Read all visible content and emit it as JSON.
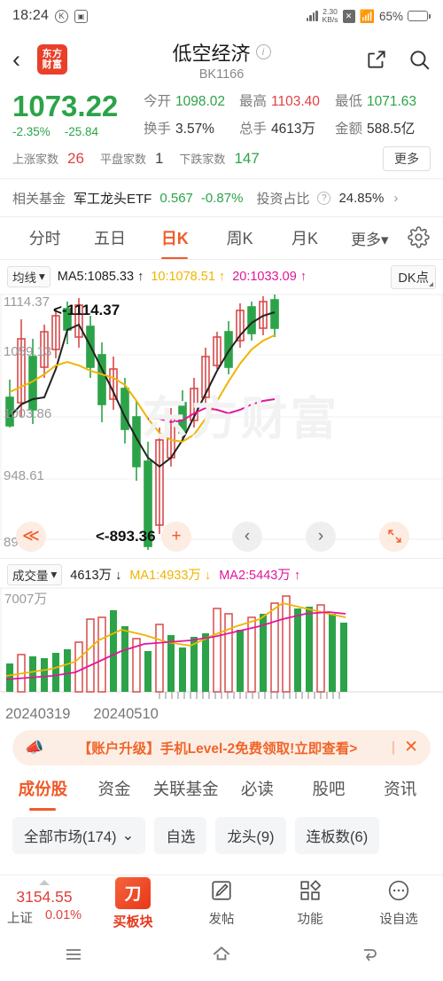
{
  "status_bar": {
    "time": "18:24",
    "icons": [
      "circle-k-icon",
      "screenshot-icon",
      "vibrate-icon",
      "sim-x-icon",
      "wifi-icon"
    ],
    "net_speed_value": "2.30",
    "net_speed_unit": "KB/s",
    "battery": "65%"
  },
  "header": {
    "back_icon": "chevron-left-icon",
    "logo_line1": "东方",
    "logo_line2": "财富",
    "title": "低空经济",
    "info_icon": "info-icon",
    "code": "BK1166",
    "share_icon": "share-icon",
    "search_icon": "search-icon"
  },
  "quote": {
    "price": "1073.22",
    "change_pct": "-2.35%",
    "change_val": "-25.84",
    "open_label": "今开",
    "open_value": "1098.02",
    "high_label": "最高",
    "high_value": "1103.40",
    "low_label": "最低",
    "low_value": "1071.63",
    "turnover_label": "换手",
    "turnover_value": "3.57%",
    "volume_label": "总手",
    "volume_value": "4613万",
    "amount_label": "金额",
    "amount_value": "588.5亿",
    "up_label": "上涨家数",
    "up_value": "26",
    "flat_label": "平盘家数",
    "flat_value": "1",
    "down_label": "下跌家数",
    "down_value": "147",
    "more_button": "更多",
    "color_up": "#e04040",
    "color_down": "#2ca349"
  },
  "fund_row": {
    "label": "相关基金",
    "name": "军工龙头ETF",
    "price": "0.567",
    "change_pct": "-0.87%",
    "ratio_label": "投资占比",
    "help_icon": "question-icon",
    "ratio_value": "24.85%",
    "arrow": "›"
  },
  "chart_tabs": {
    "items": [
      {
        "label": "分时",
        "active": false
      },
      {
        "label": "五日",
        "active": false
      },
      {
        "label": "日K",
        "active": true
      },
      {
        "label": "周K",
        "active": false
      },
      {
        "label": "月K",
        "active": false
      },
      {
        "label": "更多▾",
        "active": false
      }
    ],
    "settings_icon": "gear-icon"
  },
  "ma_bar": {
    "selector": "均线",
    "selector_caret": "▾",
    "ma5": "MA5:1085.33 ↑",
    "ma10": "10:1078.51 ↑",
    "ma20": "20:1033.09 ↑",
    "dk_button": "DK点"
  },
  "chart_data": {
    "type": "line",
    "title": "低空经济 日K",
    "y_axis_labels": [
      "1114.37",
      "1059.13",
      "1003.86",
      "948.61",
      "893.36"
    ],
    "ylim": [
      893.36,
      1114.37
    ],
    "annotation_high": "<-1114.37",
    "annotation_low": "<-893.36",
    "watermark": "东方财富",
    "series": [
      {
        "name": "MA5",
        "color": "#222222",
        "values": [
          1025,
          1018,
          1012,
          1015,
          1030,
          1050,
          1068,
          1072,
          1060,
          1040,
          1018,
          995,
          975,
          958,
          948,
          945,
          952,
          968,
          990,
          1012,
          1035,
          1052,
          1066,
          1076,
          1082,
          1085
        ]
      },
      {
        "name": "MA10",
        "color": "#f0b400",
        "values": [
          1042,
          1045,
          1046,
          1047,
          1046,
          1044,
          1040,
          1035,
          1028,
          1018,
          1006,
          995,
          985,
          978,
          974,
          972,
          975,
          982,
          995,
          1010,
          1026,
          1042,
          1056,
          1066,
          1074,
          1078
        ]
      },
      {
        "name": "MA20",
        "color": "#e0179c",
        "values": [
          null,
          null,
          null,
          null,
          null,
          null,
          null,
          null,
          null,
          null,
          null,
          null,
          1000,
          998,
          997,
          999,
          1003,
          1008,
          1010,
          1012,
          1016,
          1021,
          1025,
          1029,
          1031,
          1033
        ]
      }
    ],
    "candles_note": "K-line candles: green = down, hollow red = up",
    "volume": {
      "header_selector": "成交量",
      "header_caret": "▾",
      "current": "4613万 ↓",
      "ma1": "MA1:4933万 ↓",
      "ma2": "MA2:5443万 ↑",
      "max_label": "7007万",
      "ymax": 7007
    },
    "x_axis_labels": [
      "20240319",
      "20240510"
    ]
  },
  "chart_controls": {
    "zoom_out_icon": "double-chevron-left-icon",
    "zoom_in_icon": "plus-icon",
    "prev_icon": "chevron-left-icon",
    "next_icon": "chevron-right-icon",
    "fullscreen_icon": "expand-icon"
  },
  "banner": {
    "megaphone_icon": "megaphone-icon",
    "text": "【账户升级】手机Level-2免费领取!立即查看>",
    "separator": "|",
    "close_icon": "✕"
  },
  "bottom_tabs": {
    "items": [
      {
        "label": "成份股",
        "active": true
      },
      {
        "label": "资金",
        "active": false
      },
      {
        "label": "关联基金",
        "active": false
      },
      {
        "label": "必读",
        "active": false
      },
      {
        "label": "股吧",
        "active": false
      },
      {
        "label": "资讯",
        "active": false
      }
    ]
  },
  "filter_chips": [
    {
      "label": "全部市场(174)",
      "caret": "⌄"
    },
    {
      "label": "自选",
      "caret": ""
    },
    {
      "label": "龙头(9)",
      "caret": ""
    },
    {
      "label": "连板数(6)",
      "caret": ""
    }
  ],
  "action_bar": {
    "index_value": "3154.55",
    "index_name": "上证",
    "index_pct": "0.01%",
    "buy_label": "买板块",
    "post_label": "发帖",
    "post_icon": "edit-icon",
    "function_label": "功能",
    "function_icon": "grid-icon",
    "watchlist_label": "设自选",
    "watchlist_icon": "more-icon"
  },
  "nav_bar": {
    "recents_icon": "menu-icon",
    "home_icon": "home-icon",
    "back_icon": "back-icon"
  }
}
